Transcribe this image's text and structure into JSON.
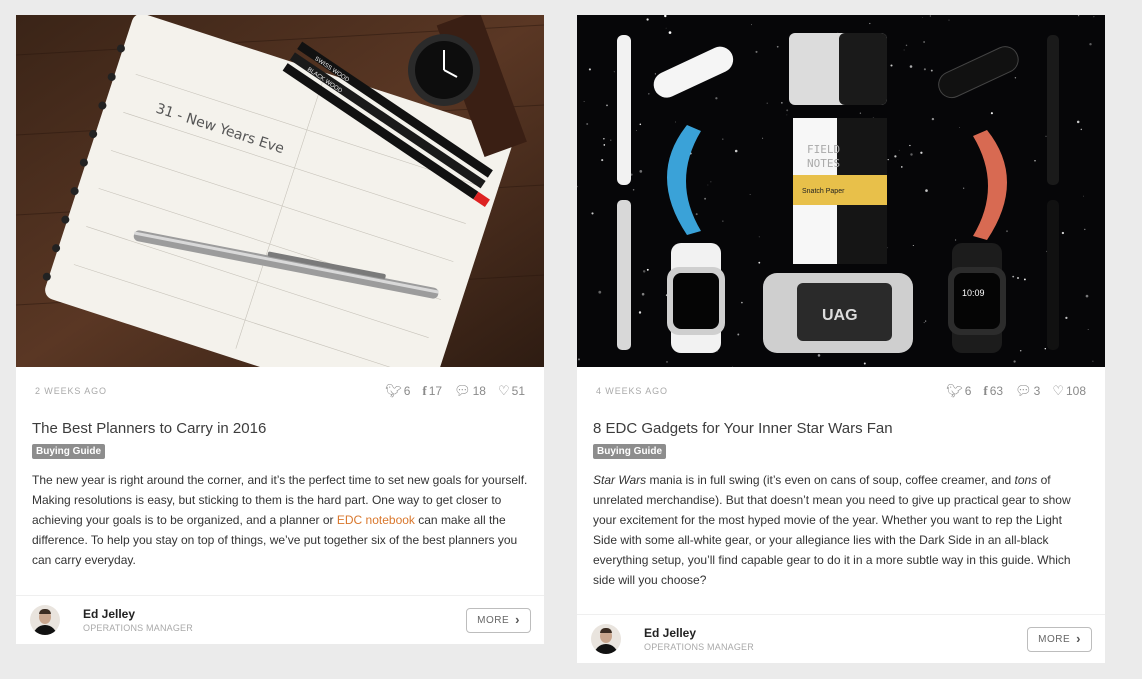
{
  "colors": {
    "background": "#ebebeb",
    "card": "#ffffff",
    "link": "#d9772c",
    "badge": "#8d8d8d"
  },
  "cards": [
    {
      "image_alt": "Spiral notebook with pen, pencils and watch on wooden table",
      "date": "2 WEEKS AGO",
      "stats": {
        "twitter": "6",
        "facebook": "17",
        "comments": "18",
        "likes": "51"
      },
      "title": "The Best Planners to Carry in 2016",
      "badge": "Buying Guide",
      "excerpt_a": "The new year is right around the corner, and it’s the perfect time to set new goals for yourself. Making resolutions is easy, but sticking to them is the hard part. One way to get closer to achieving your goals is to be organized, and a planner or ",
      "excerpt_link": "EDC notebook",
      "excerpt_b": " can make all the difference. To help you stay on top of things, we’ve put together six of the best planners you can carry everyday.",
      "author_name": "Ed Jelley",
      "author_role": "OPERATIONS MANAGER",
      "more_label": "MORE",
      "notebook_text": "31 - New Years Eve",
      "pencil_text": "SWISS WOOD",
      "pencil_text2": "BLACK WOOD"
    },
    {
      "image_alt": "White and black EDC gear laid out on a starfield background",
      "date": "4 WEEKS AGO",
      "stats": {
        "twitter": "6",
        "facebook": "63",
        "comments": "3",
        "likes": "108"
      },
      "title": "8 EDC Gadgets for Your Inner Star Wars Fan",
      "badge": "Buying Guide",
      "excerpt_em": "Star Wars",
      "excerpt_a": " mania is in full swing (it’s even on cans of soup, coffee creamer, and ",
      "excerpt_em2": "tons",
      "excerpt_b": " of unrelated merchandise). But that doesn’t mean you need to give up practical gear to show your excitement for the most hyped movie of the year. Whether you want to rep the Light Side with some all-white gear, or your allegiance lies with the Dark Side in an all-black everything setup, you’ll find capable gear to do it in a more subtle way in this guide. Which side will you choose?",
      "author_name": "Ed Jelley",
      "author_role": "OPERATIONS MANAGER",
      "more_label": "MORE",
      "notebook_text_1": "FIELD",
      "notebook_text_2": "NOTES",
      "notebook_text_3": "Snatch Paper",
      "phone_text": "UAG",
      "watch_time": "10:09"
    }
  ]
}
